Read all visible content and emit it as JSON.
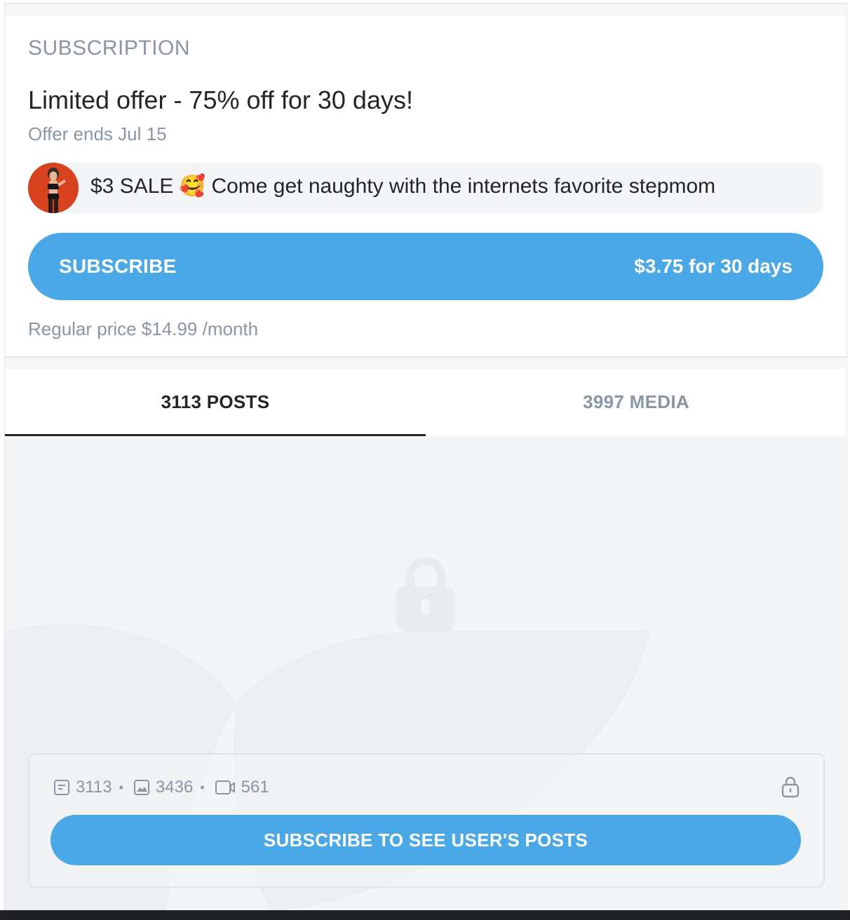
{
  "subscription": {
    "heading": "SUBSCRIPTION",
    "offer_title": "Limited offer - 75% off for 30 days!",
    "offer_ends": "Offer ends Jul 15",
    "promo_message": "$3 SALE 🥰 Come get naughty with the internets favorite stepmom",
    "subscribe_label": "SUBSCRIBE",
    "subscribe_price": "$3.75 for 30 days",
    "regular_price": "Regular price $14.99 /month"
  },
  "tabs": [
    {
      "label": "3113 POSTS",
      "active": true
    },
    {
      "label": "3997 MEDIA",
      "active": false
    }
  ],
  "locked": {
    "posts_count": "3113",
    "photos_count": "3436",
    "videos_count": "561",
    "separator": "•",
    "cta_label": "SUBSCRIBE TO SEE USER'S POSTS"
  },
  "colors": {
    "accent": "#4aa8e6",
    "muted_text": "#8a96a3",
    "dark_text": "#242529",
    "avatar_bg": "#d8431f"
  },
  "icons": [
    "posts-icon",
    "photo-icon",
    "video-icon",
    "lock-icon"
  ]
}
